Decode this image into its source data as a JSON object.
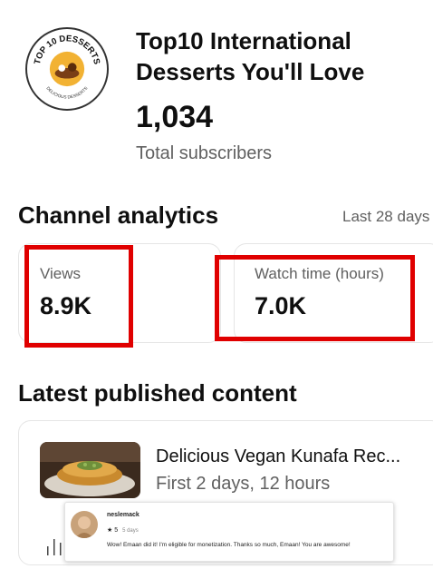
{
  "header": {
    "logo": {
      "icon": "top10-desserts-logo-icon",
      "top_text": "TOP 10 DESSERTS",
      "bottom_text": "DELICIOUS DESSERTS"
    },
    "channel_title_line1": "Top10 International",
    "channel_title_line2": "Desserts You'll Love",
    "subscriber_count": "1,034",
    "subscriber_label": "Total subscribers"
  },
  "analytics": {
    "title": "Channel analytics",
    "range": "Last 28 days",
    "metrics": [
      {
        "label": "Views",
        "value": "8.9K"
      },
      {
        "label": "Watch time (hours)",
        "value": "7.0K"
      }
    ],
    "highlight_color": "#e00000"
  },
  "latest": {
    "title": "Latest published content",
    "video": {
      "title": "Delicious Vegan Kunafa Rec...",
      "meta": "First 2 days, 12 hours",
      "thumbnail_icon": "kunafa-thumbnail-icon"
    }
  },
  "review": {
    "name": "neslemack",
    "rating": "5",
    "age": "5 days",
    "text": "Wow! Emaan did it! I'm eligible for monetization. Thanks so much, Emaan! You are awesome!"
  }
}
